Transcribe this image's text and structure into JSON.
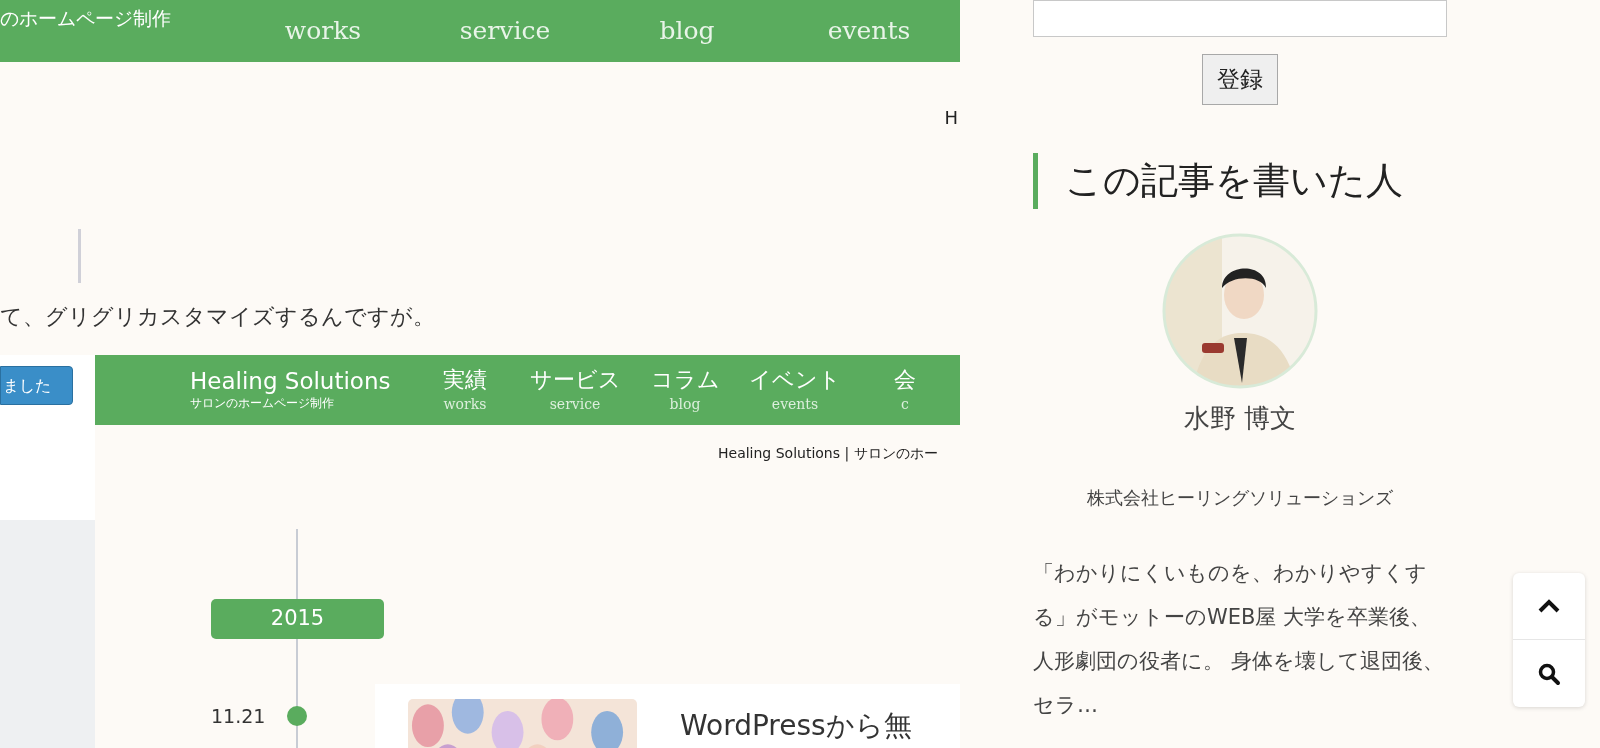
{
  "article": {
    "screenshot_1": {
      "site_subtitle": "のホームページ制作",
      "nav": [
        {
          "en": "works"
        },
        {
          "en": "service"
        },
        {
          "en": "blog"
        },
        {
          "en": "events"
        }
      ],
      "breadcrumb": "H"
    },
    "paragraph": "て、グリグリカスタマイズするんですが。",
    "screenshot_2": {
      "side_button": "ました",
      "site_title": "Healing Solutions",
      "site_subtitle": "サロンのホームページ制作",
      "nav": [
        {
          "ja": "実績",
          "en": "works"
        },
        {
          "ja": "サービス",
          "en": "service"
        },
        {
          "ja": "コラム",
          "en": "blog"
        },
        {
          "ja": "イベント",
          "en": "events"
        },
        {
          "ja": "会",
          "en": "c"
        }
      ],
      "breadcrumb": "Healing Solutions | サロンのホー",
      "timeline": {
        "year": "2015",
        "date": "11.21",
        "post_title": "WordPressから無"
      }
    }
  },
  "sidebar": {
    "submit_button": "登録",
    "author_heading": "この記事を書いた人",
    "author": {
      "name": "水野 博文",
      "company": "株式会社ヒーリングソリューションズ",
      "bio": "「わかりにくいものを、わかりやすくする」がモットーのWEB屋 大学を卒業後、人形劇団の役者に。 身体を壊して退団後、セラ…"
    }
  }
}
